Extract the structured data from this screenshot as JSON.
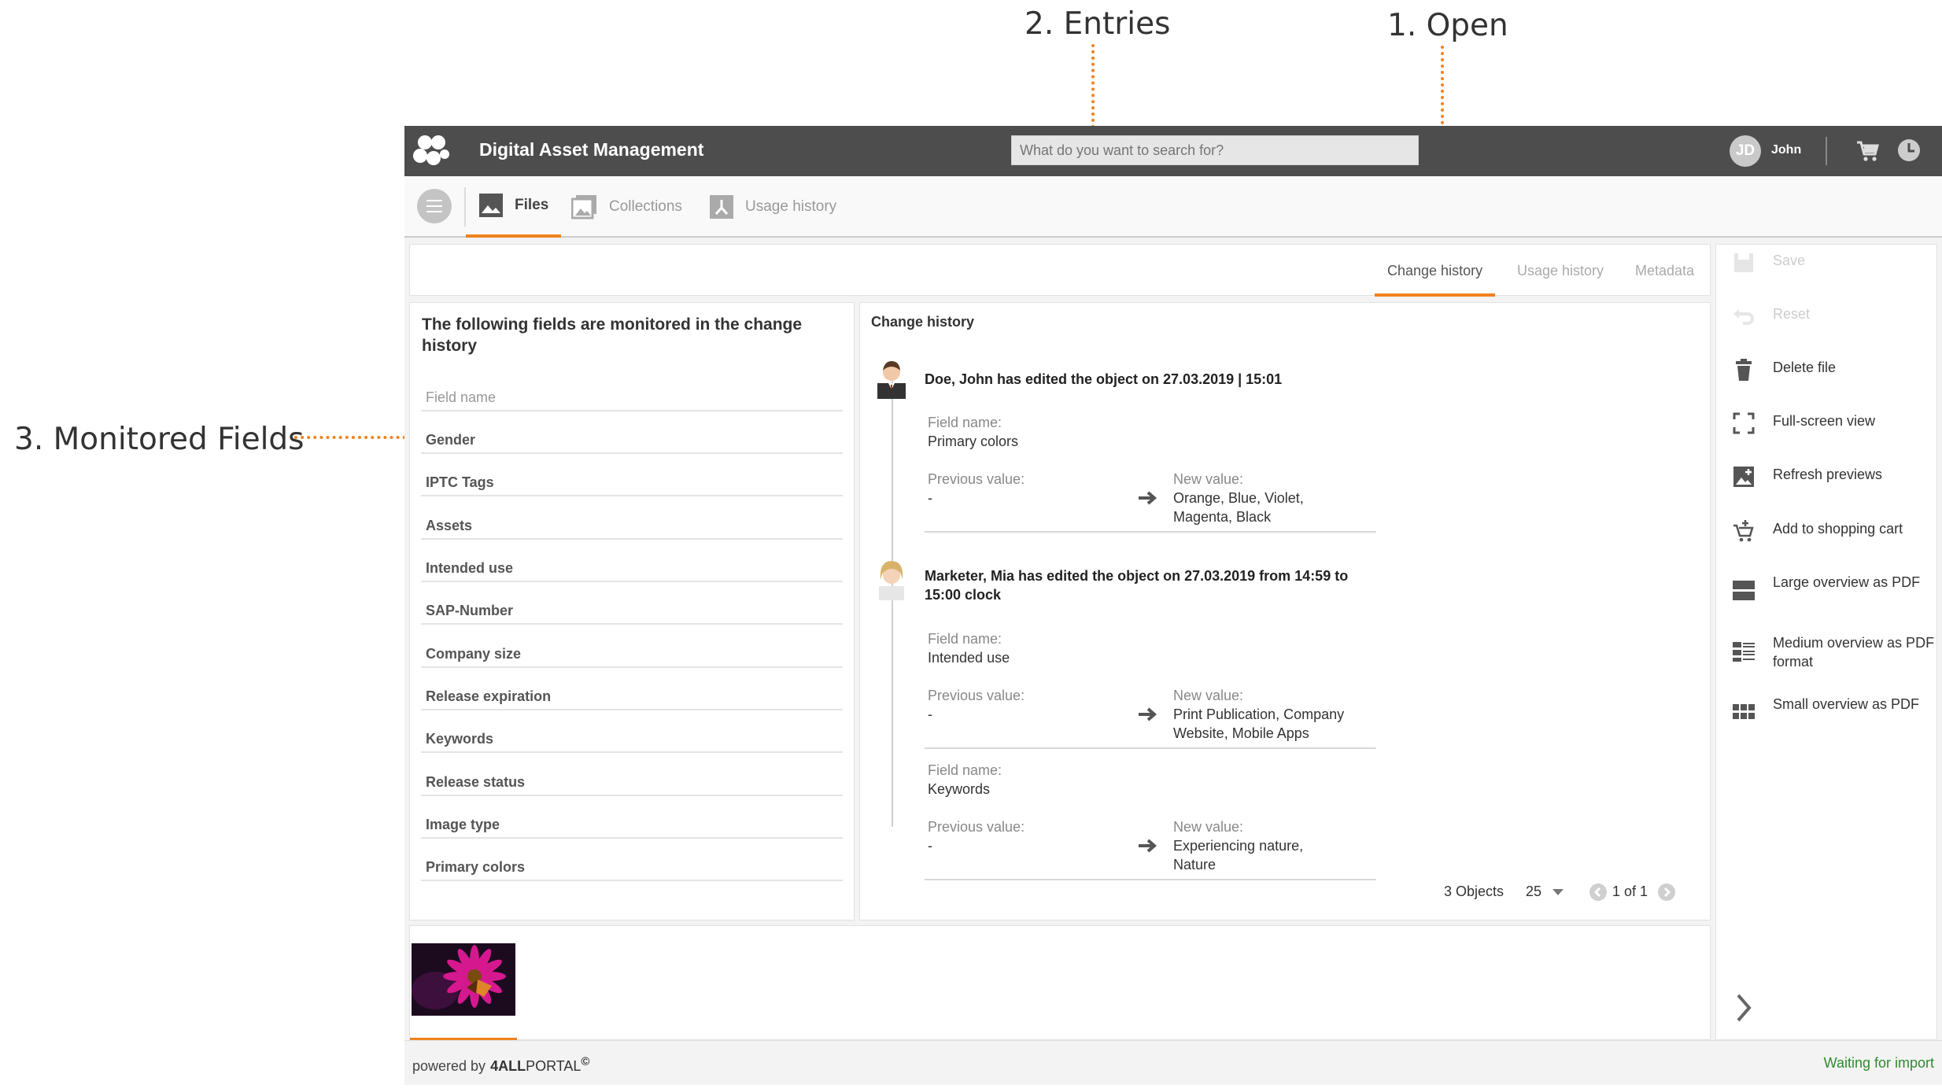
{
  "annotations": {
    "open": "1. Open",
    "entries": "2. Entries",
    "monitored": "3. Monitored Fields"
  },
  "app": {
    "title": "Digital Asset Management",
    "search_placeholder": "What do you want to search for?",
    "user_initials": "JD",
    "user_name": "John"
  },
  "nav": {
    "tabs": [
      {
        "label": "Files",
        "icon": "image-icon",
        "active": true
      },
      {
        "label": "Collections",
        "icon": "collections-icon",
        "active": false
      },
      {
        "label": "Usage history",
        "icon": "usage-icon",
        "active": false
      }
    ]
  },
  "detail_tabs": [
    "Change history",
    "Usage history",
    "Metadata"
  ],
  "fields_panel": {
    "title": "The following fields are monitored in the change history",
    "header": "Field name",
    "fields": [
      "Gender",
      "IPTC Tags",
      "Assets",
      "Intended use",
      "SAP-Number",
      "Company size",
      "Release expiration",
      "Keywords",
      "Release status",
      "Image type",
      "Primary colors"
    ]
  },
  "history": {
    "title": "Change history",
    "field_label": "Field name:",
    "previous_label": "Previous value:",
    "new_label": "New value:",
    "entries": [
      {
        "title": "Doe, John has edited the object on 27.03.2019 | 15:01",
        "changes": [
          {
            "field": "Primary colors",
            "previous": "-",
            "new_line1": "Orange, Blue, Violet,",
            "new_line2": "Magenta, Black"
          }
        ]
      },
      {
        "title_line1": "Marketer, Mia has edited the object on 27.03.2019 from 14:59 to",
        "title_line2": "15:00 clock",
        "changes": [
          {
            "field": "Intended use",
            "previous": "-",
            "new_line1": "Print Publication, Company",
            "new_line2": "Website, Mobile Apps"
          },
          {
            "field": "Keywords",
            "previous": "-",
            "new_line1": "Experiencing nature,",
            "new_line2": "Nature"
          }
        ]
      }
    ],
    "objects_count": "3 Objects",
    "page_size": "25",
    "page_of": "1 of 1"
  },
  "actions": [
    {
      "label": "Save",
      "icon": "save-icon",
      "disabled": true
    },
    {
      "label": "Reset",
      "icon": "undo-icon",
      "disabled": true
    },
    {
      "label": "Delete file",
      "icon": "trash-icon",
      "disabled": false
    },
    {
      "label": "Full-screen view",
      "icon": "fullscreen-icon",
      "disabled": false
    },
    {
      "label": "Refresh previews",
      "icon": "refresh-preview-icon",
      "disabled": false
    },
    {
      "label": "Add to shopping cart",
      "icon": "cart-add-icon",
      "disabled": false
    },
    {
      "label": "Large overview as PDF",
      "icon": "large-overview-icon",
      "disabled": false
    },
    {
      "label": "Medium overview as PDF format",
      "icon": "medium-overview-icon",
      "disabled": false
    },
    {
      "label": "Small overview as PDF",
      "icon": "small-overview-icon",
      "disabled": false
    }
  ],
  "footer": {
    "powered_by": "powered by",
    "brand_bold": "4ALL",
    "brand_rest": "PORTAL",
    "brand_mark": "©",
    "status": "Waiting for import"
  },
  "colors": {
    "accent": "#f0821e",
    "topbar": "#4d4d4d",
    "status_ok": "#2e8b2e"
  }
}
